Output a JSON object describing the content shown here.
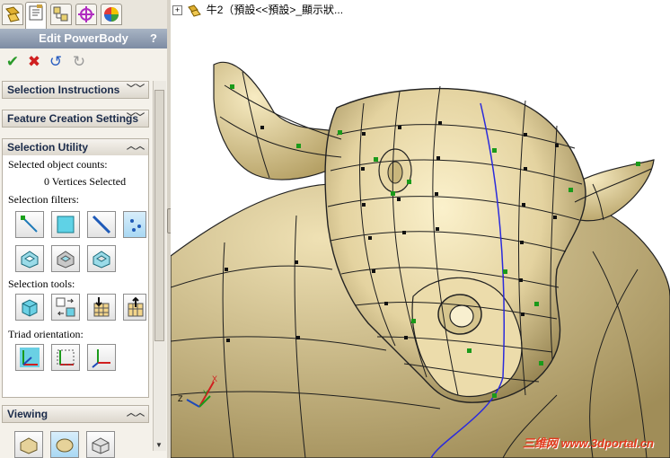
{
  "panel": {
    "title": "Edit PowerBody",
    "help": "?",
    "tabs": [
      "feature-manager-icon",
      "property-manager-icon",
      "configuration-manager-icon",
      "dimxpert-icon",
      "display-manager-icon"
    ],
    "actions": {
      "ok": "✔",
      "cancel": "✖",
      "undo": "↺",
      "redo": "↻"
    },
    "sections": {
      "selection_instructions": "Selection Instructions",
      "feature_creation_settings": "Feature Creation Settings",
      "selection_utility": "Selection Utility",
      "viewing": "Viewing"
    },
    "selection_utility": {
      "counts_label": "Selected object counts:",
      "counts_value": "0 Vertices Selected",
      "filters_label": "Selection filters:",
      "tools_label": "Selection tools:",
      "triad_label": "Triad orientation:"
    }
  },
  "viewport": {
    "tree_item": "牛2（預設<<預設>_顯示狀...",
    "triad": {
      "x": "X",
      "y": "Y",
      "z": "Z"
    },
    "watermark": "三维网 www.3dportal.cn"
  },
  "colors": {
    "accent": "#7d8ca3",
    "model": "#e8d9a6",
    "ok": "#2a9a2a",
    "cancel": "#d01f1f"
  }
}
